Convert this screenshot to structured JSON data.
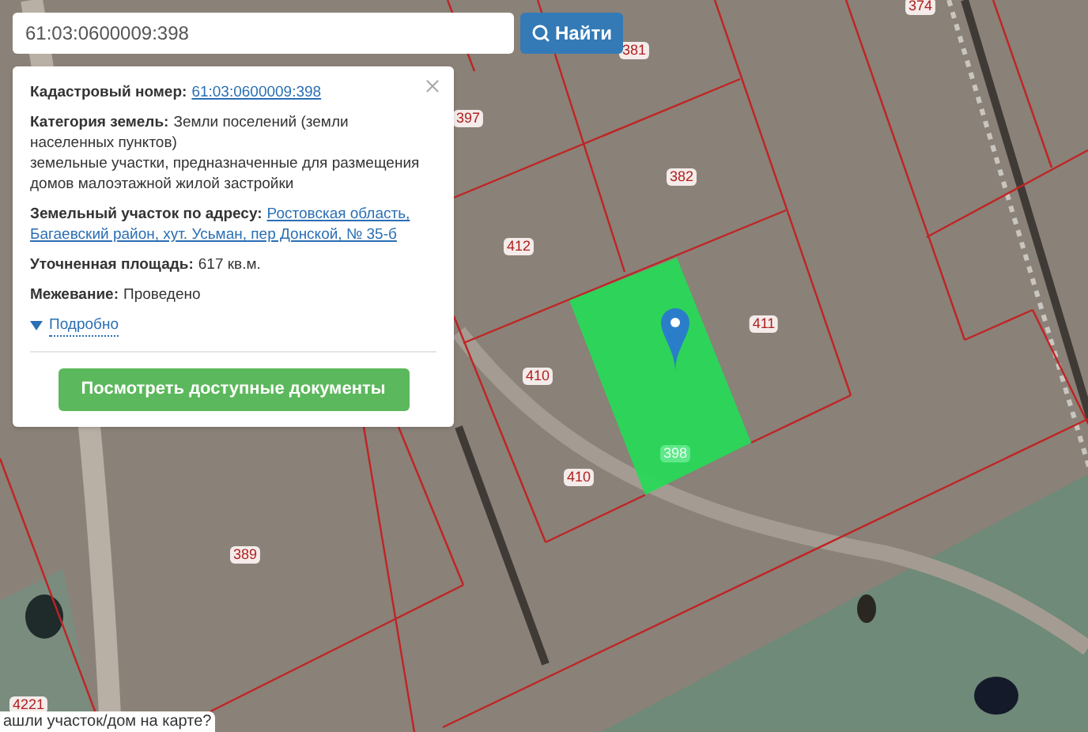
{
  "search": {
    "value": "61:03:0600009:398",
    "button": "Найти"
  },
  "popup": {
    "fields": [
      {
        "label": "Кадастровый номер:",
        "kind": "link",
        "lines": [
          "61:03:0600009:398"
        ]
      },
      {
        "label": "Категория земель:",
        "kind": "text",
        "lines": [
          "Земли поселений (земли",
          "населенных пунктов)"
        ],
        "detail": [
          "земельные участки, предназначенные для размещения",
          "домов малоэтажной жилой застройки"
        ]
      },
      {
        "label": "Земельный участок по адресу:",
        "kind": "link",
        "lines": [
          "Ростовская область,",
          "Багаевский район, хут. Усьман, пер Донской, № 35-б"
        ]
      },
      {
        "label": "Уточненная площадь:",
        "kind": "text",
        "lines": [
          "617 кв.м."
        ]
      },
      {
        "label": "Межевание:",
        "kind": "text",
        "lines": [
          "Проведено"
        ]
      }
    ],
    "more_link": {
      "label": "Подробно",
      "expanded": false
    },
    "docs_button": "Посмотреть доступные документы"
  },
  "map": {
    "parcel_labels": [
      {
        "text": "381",
        "selected": false
      },
      {
        "text": "374",
        "selected": false
      },
      {
        "text": "397",
        "selected": false
      },
      {
        "text": "382",
        "selected": false
      },
      {
        "text": "412",
        "selected": false
      },
      {
        "text": "411",
        "selected": false
      },
      {
        "text": "410",
        "selected": false
      },
      {
        "text": "410",
        "selected": false
      },
      {
        "text": "398",
        "selected": true
      },
      {
        "text": "389",
        "selected": false
      },
      {
        "text": "4221",
        "selected": false
      }
    ]
  },
  "bottom_tip": "ашли участок/дом на карте?"
}
